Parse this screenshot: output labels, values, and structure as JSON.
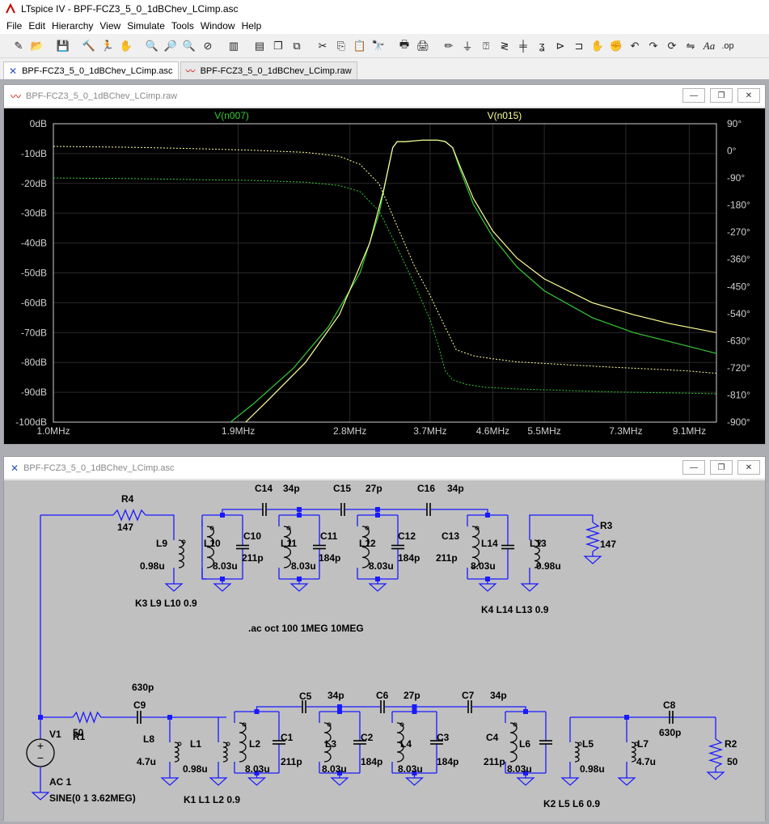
{
  "app": {
    "title": "LTspice IV - BPF-FCZ3_5_0_1dBChev_LCimp.asc"
  },
  "menu": [
    "File",
    "Edit",
    "Hierarchy",
    "View",
    "Simulate",
    "Tools",
    "Window",
    "Help"
  ],
  "toolbar_icons": [
    "new-schematic-icon",
    "open-icon",
    "save-icon",
    "control-panel-icon",
    "run-icon",
    "halt-icon",
    "zoom-in-icon",
    "pan-icon",
    "zoom-out-icon",
    "zoom-cancel-icon",
    "autorange-icon",
    "tile-horizontal-icon",
    "cascade-icon",
    "close-all-icon",
    "cut-icon",
    "copy-icon",
    "paste-icon",
    "find-icon",
    "print-setup-icon",
    "print-icon",
    "draw-wire-icon",
    "ground-icon",
    "label-net-icon",
    "resistor-icon",
    "capacitor-icon",
    "inductor-icon",
    "diode-icon",
    "component-icon",
    "move-icon",
    "drag-icon",
    "undo-icon",
    "redo-icon",
    "rotate-icon",
    "mirror-icon",
    "text-icon",
    "spice-directive-icon"
  ],
  "tabs": [
    {
      "label": "BPF-FCZ3_5_0_1dBChev_LCimp.asc",
      "icon": "schematic-icon"
    },
    {
      "label": "BPF-FCZ3_5_0_1dBChev_LCimp.raw",
      "icon": "waveform-icon"
    }
  ],
  "plot_window": {
    "title": "BPF-FCZ3_5_0_1dBChev_LCimp.raw"
  },
  "schematic_window": {
    "title": "BPF-FCZ3_5_0_1dBChev_LCimp.asc"
  },
  "chart_data": {
    "type": "line",
    "x_scale": "log",
    "x_ticks": [
      "1.0MHz",
      "1.9MHz",
      "2.8MHz",
      "3.7MHz",
      "4.6MHz",
      "5.5MHz",
      "7.3MHz",
      "9.1MHz"
    ],
    "x_tick_values": [
      1.0,
      1.9,
      2.8,
      3.7,
      4.6,
      5.5,
      7.3,
      9.1
    ],
    "y_ticks": [
      "0dB",
      "-10dB",
      "-20dB",
      "-30dB",
      "-40dB",
      "-50dB",
      "-60dB",
      "-70dB",
      "-80dB",
      "-90dB",
      "-100dB"
    ],
    "y_tick_values": [
      0,
      -10,
      -20,
      -30,
      -40,
      -50,
      -60,
      -70,
      -80,
      -90,
      -100
    ],
    "y2_ticks": [
      "90°",
      "0°",
      "-90°",
      "-180°",
      "-270°",
      "-360°",
      "-450°",
      "-540°",
      "-630°",
      "-720°",
      "-810°",
      "-900°"
    ],
    "y2_tick_values": [
      90,
      0,
      -90,
      -180,
      -270,
      -360,
      -450,
      -540,
      -630,
      -720,
      -810,
      -900
    ],
    "xlim": [
      1.0,
      10.0
    ],
    "ylim": [
      -100,
      0
    ],
    "y2lim": [
      -900,
      90
    ],
    "series": [
      {
        "name": "V(n007)",
        "color": "#33cc33",
        "magnitude": {
          "x": [
            1.85,
            2.0,
            2.3,
            2.6,
            2.9,
            3.1,
            3.2,
            3.25,
            3.3,
            3.4,
            3.6,
            3.8,
            3.9,
            4.0,
            4.1,
            4.3,
            4.6,
            5.0,
            5.5,
            6.5,
            7.5,
            8.5,
            10.0
          ],
          "y": [
            -100,
            -94,
            -82,
            -68,
            -50,
            -30,
            -15,
            -8,
            -6,
            -6,
            -5.5,
            -5.5,
            -6,
            -8,
            -15,
            -27,
            -38,
            -48,
            -56,
            -65,
            -70,
            -73,
            -77
          ]
        },
        "phase": {
          "x": [
            1.0,
            1.3,
            1.6,
            2.0,
            2.4,
            2.7,
            2.9,
            3.1,
            3.3,
            3.5,
            3.7,
            3.8,
            3.9,
            4.0,
            4.2,
            4.5,
            5.0,
            6.0,
            7.0,
            8.0,
            9.0,
            10.0
          ],
          "y": [
            -90,
            -92,
            -95,
            -98,
            -104,
            -115,
            -135,
            -200,
            -320,
            -440,
            -560,
            -640,
            -730,
            -760,
            -775,
            -785,
            -790,
            -795,
            -800,
            -802,
            -804,
            -806
          ]
        }
      },
      {
        "name": "V(n015)",
        "color": "#ffff99",
        "magnitude": {
          "x": [
            1.95,
            2.1,
            2.4,
            2.7,
            3.0,
            3.15,
            3.25,
            3.3,
            3.4,
            3.6,
            3.8,
            3.9,
            4.0,
            4.1,
            4.3,
            4.6,
            5.0,
            5.5,
            6.5,
            7.5,
            8.5,
            10.0
          ],
          "y": [
            -100,
            -93,
            -80,
            -64,
            -40,
            -22,
            -8,
            -6,
            -6,
            -5.5,
            -5.5,
            -6,
            -8,
            -14,
            -25,
            -36,
            -45,
            -52,
            -60,
            -64,
            -67,
            -70
          ]
        },
        "phase": {
          "x": [
            1.0,
            1.3,
            1.6,
            2.0,
            2.4,
            2.7,
            2.9,
            3.1,
            3.3,
            3.5,
            3.7,
            3.85,
            3.95,
            4.05,
            4.3,
            4.6,
            5.0,
            6.0,
            7.0,
            8.0,
            9.0,
            10.0
          ],
          "y": [
            15,
            12,
            8,
            2,
            -5,
            -18,
            -45,
            -110,
            -250,
            -380,
            -480,
            -560,
            -610,
            -660,
            -680,
            -690,
            -700,
            -710,
            -718,
            -724,
            -730,
            -738
          ]
        }
      }
    ]
  },
  "schematic": {
    "directive": ".ac oct 100 1MEG 10MEG",
    "labels": [
      {
        "t": "R4"
      },
      {
        "t": "147"
      },
      {
        "t": "C14"
      },
      {
        "t": "34p"
      },
      {
        "t": "C15"
      },
      {
        "t": "27p"
      },
      {
        "t": "C16"
      },
      {
        "t": "34p"
      },
      {
        "t": "R3"
      },
      {
        "t": "147"
      },
      {
        "t": "L9"
      },
      {
        "t": "0.98u"
      },
      {
        "t": "L10"
      },
      {
        "t": "8.03u"
      },
      {
        "t": "C10"
      },
      {
        "t": "211p"
      },
      {
        "t": "L11"
      },
      {
        "t": "8.03u"
      },
      {
        "t": "C11"
      },
      {
        "t": "184p"
      },
      {
        "t": "L12"
      },
      {
        "t": "8.03u"
      },
      {
        "t": "C12"
      },
      {
        "t": "184p"
      },
      {
        "t": "C13"
      },
      {
        "t": "211p"
      },
      {
        "t": "L14"
      },
      {
        "t": "8.03u"
      },
      {
        "t": "L13"
      },
      {
        "t": "0.98u"
      },
      {
        "t": "K3 L9 L10 0.9"
      },
      {
        "t": "K4 L14 L13 0.9"
      },
      {
        "t": "R1"
      },
      {
        "t": "50"
      },
      {
        "t": "630p"
      },
      {
        "t": "C9"
      },
      {
        "t": "C5"
      },
      {
        "t": "34p"
      },
      {
        "t": "C6"
      },
      {
        "t": "27p"
      },
      {
        "t": "C7"
      },
      {
        "t": "34p"
      },
      {
        "t": "C8"
      },
      {
        "t": "630p"
      },
      {
        "t": "V1"
      },
      {
        "t": "L8"
      },
      {
        "t": "4.7u"
      },
      {
        "t": "L1"
      },
      {
        "t": "0.98u"
      },
      {
        "t": "L2"
      },
      {
        "t": "8.03u"
      },
      {
        "t": "C1"
      },
      {
        "t": "211p"
      },
      {
        "t": "L3"
      },
      {
        "t": "8.03u"
      },
      {
        "t": "C2"
      },
      {
        "t": "184p"
      },
      {
        "t": "L4"
      },
      {
        "t": "8.03u"
      },
      {
        "t": "C3"
      },
      {
        "t": "184p"
      },
      {
        "t": "C4"
      },
      {
        "t": "211p"
      },
      {
        "t": "L6"
      },
      {
        "t": "8.03u"
      },
      {
        "t": "L5"
      },
      {
        "t": "0.98u"
      },
      {
        "t": "L7"
      },
      {
        "t": "4.7u"
      },
      {
        "t": "R2"
      },
      {
        "t": "50"
      },
      {
        "t": "AC 1"
      },
      {
        "t": "SINE(0 1 3.62MEG)"
      },
      {
        "t": "K1 L1 L2 0.9"
      },
      {
        "t": "K2 L5 L6 0.9"
      }
    ]
  }
}
